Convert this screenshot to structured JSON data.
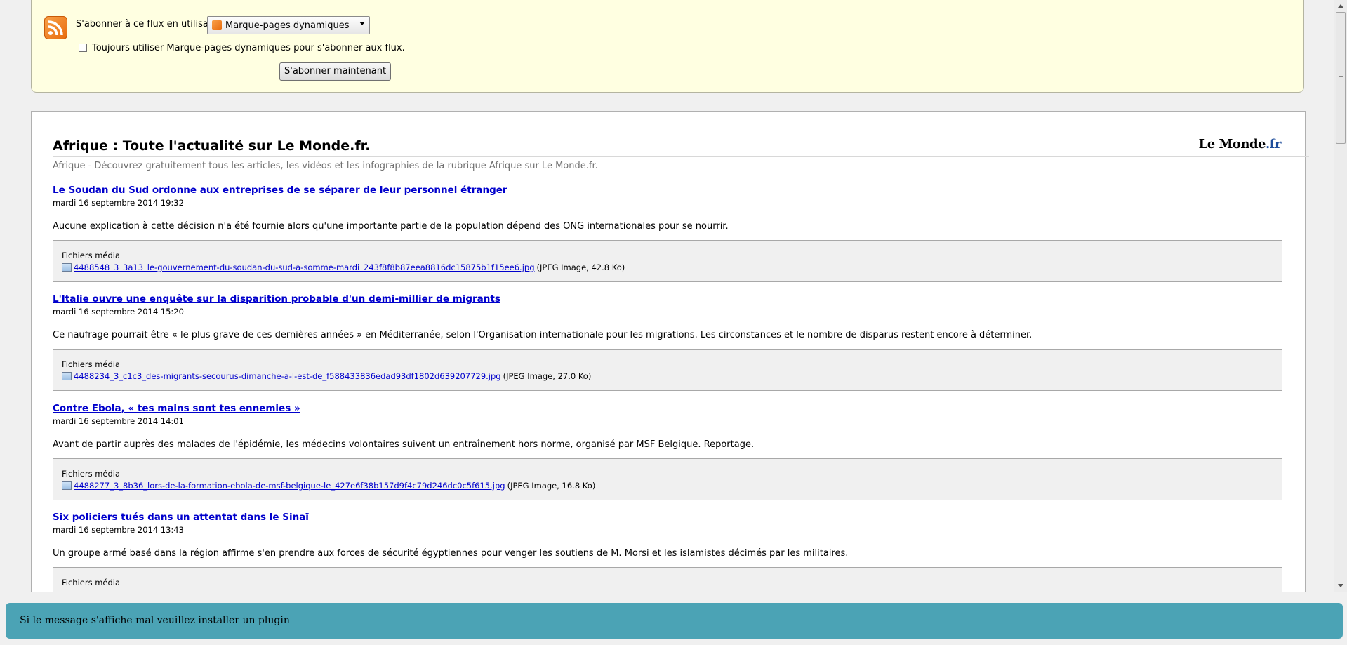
{
  "subscribe": {
    "label": "S'abonner à ce flux en utilisant",
    "reader_selected": "Marque-pages dynamiques",
    "always_use_label": "Toujours utiliser Marque-pages dynamiques pour s'abonner aux flux.",
    "subscribe_button": "S'abonner maintenant"
  },
  "feed": {
    "title": "Afrique : Toute l'actualité sur Le Monde.fr.",
    "subtitle": "Afrique - Découvrez gratuitement tous les articles, les vidéos et les infographies de la rubrique Afrique sur Le Monde.fr.",
    "logo_main": "Le Monde",
    "logo_suffix": ".fr",
    "media_heading": "Fichiers média",
    "entries": [
      {
        "title": "Le Soudan du Sud ordonne aux entreprises de se séparer de leur personnel étranger",
        "date": "mardi 16 septembre 2014 19:32",
        "summary": "Aucune explication à cette décision n'a été fournie alors qu'une importante partie de la population dépend des ONG internationales pour se nourrir.",
        "media_file": "4488548_3_3a13_le-gouvernement-du-soudan-du-sud-a-somme-mardi_243f8f8b87eea8816dc15875b1f15ee6.jpg",
        "media_info": "(JPEG Image, 42.8 Ko)"
      },
      {
        "title": "L'Italie ouvre une enquête sur la disparition probable d'un demi-millier de migrants",
        "date": "mardi 16 septembre 2014 15:20",
        "summary": "Ce naufrage pourrait être « le plus grave de ces dernières années » en Méditerranée, selon l'Organisation internationale pour les migrations. Les circonstances et le nombre de disparus restent encore à déterminer.",
        "media_file": "4488234_3_c1c3_des-migrants-secourus-dimanche-a-l-est-de_f588433836edad93df1802d639207729.jpg",
        "media_info": "(JPEG Image, 27.0 Ko)"
      },
      {
        "title": "Contre Ebola, « tes mains sont tes ennemies »",
        "date": "mardi 16 septembre 2014 14:01",
        "summary": "Avant de partir auprès des malades de l'épidémie, les médecins volontaires suivent un entraînement hors norme, organisé par MSF Belgique. Reportage.",
        "media_file": "4488277_3_8b36_lors-de-la-formation-ebola-de-msf-belgique-le_427e6f38b157d9f4c79d246dc0c5f615.jpg",
        "media_info": "(JPEG Image, 16.8 Ko)"
      },
      {
        "title": "Six policiers tués dans un attentat dans le Sinaï",
        "date": "mardi 16 septembre 2014 13:43",
        "summary": "Un groupe armé basé dans la région affirme s'en prendre aux forces de sécurité égyptiennes pour venger les soutiens de M. Morsi et les islamistes décimés par les militaires."
      }
    ]
  },
  "banner": {
    "text": "Si le message s'affiche mal veuillez installer un plugin"
  }
}
